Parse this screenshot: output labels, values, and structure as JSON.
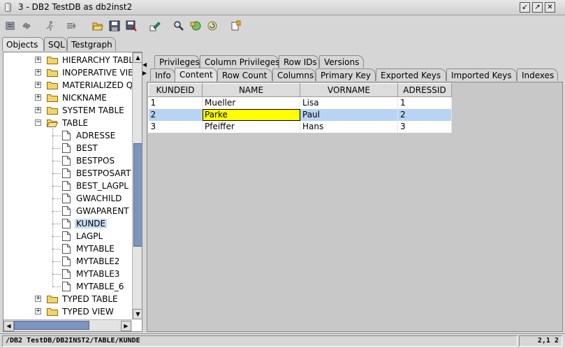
{
  "window": {
    "title": "3 - DB2 TestDB  as db2inst2",
    "controls": [
      "minimize-icon",
      "maximize-icon",
      "close-icon"
    ]
  },
  "toolbar": {
    "icons": [
      "connect-icon",
      "disconnect-icon",
      "run-icon",
      "step-icon",
      "open-folder-icon",
      "save-icon",
      "save-as-icon",
      "edit-icon",
      "search-icon",
      "export-icon",
      "refresh-icon",
      "bookmark-icon"
    ]
  },
  "left_tabs": [
    "Objects",
    "SQL",
    "Testgraph"
  ],
  "tree": {
    "categories_before": [
      "HIERARCHY TABLE",
      "INOPERATIVE VIEW",
      "MATERIALIZED QUERY",
      "NICKNAME",
      "SYSTEM TABLE"
    ],
    "expanded": "TABLE",
    "tables": [
      "ADRESSE",
      "BEST",
      "BESTPOS",
      "BESTPOSART",
      "BEST_LAGPL",
      "GWACHILD",
      "GWAPARENT",
      "KUNDE",
      "LAGPL",
      "MYTABLE",
      "MYTABLE2",
      "MYTABLE3",
      "MYTABLE_6"
    ],
    "selected": "KUNDE",
    "categories_after": [
      "TYPED TABLE",
      "TYPED VIEW"
    ]
  },
  "right_tabs": {
    "row1": [
      "Privileges",
      "Column Privileges",
      "Row IDs",
      "Versions"
    ],
    "row2": [
      "Info",
      "Content",
      "Row Count",
      "Columns",
      "Primary Key",
      "Exported Keys",
      "Imported Keys",
      "Indexes"
    ],
    "active": "Content"
  },
  "grid": {
    "columns": [
      "KUNDEID",
      "NAME",
      "VORNAME",
      "ADRESSID"
    ],
    "rows": [
      [
        "1",
        "Mueller",
        "Lisa",
        "1"
      ],
      [
        "2",
        "Parke",
        "Paul",
        "2"
      ],
      [
        "3",
        "Pfeiffer",
        "Hans",
        "3"
      ]
    ],
    "selected_row": 1,
    "editing_cell": "Parke"
  },
  "status": {
    "path": "/DB2 TestDB/DB2INST2/TABLE/KUNDE",
    "position": "2,1 2"
  },
  "colors": {
    "selection": "#b8d3f3",
    "edit_cell": "#ffff00",
    "scroll_thumb": "#7d95be"
  }
}
